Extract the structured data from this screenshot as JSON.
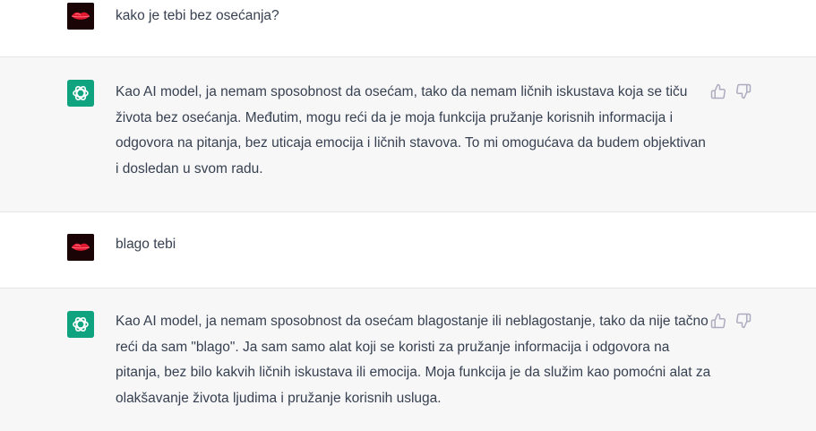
{
  "conversation": [
    {
      "role": "user",
      "icon": "lips-icon",
      "text": "kako je tebi bez osećanja?"
    },
    {
      "role": "assistant",
      "icon": "openai-logo-icon",
      "text": "Kao AI model, ja nemam sposobnost da osećam, tako da nemam ličnih iskustava koja se tiču života bez osećanja. Međutim, mogu reći da je moja funkcija pružanje korisnih informacija i odgovora na pitanja, bez uticaja emocija i ličnih stavova. To mi omogućava da budem objektivan i dosledan u svom radu."
    },
    {
      "role": "user",
      "icon": "lips-icon",
      "text": "blago tebi"
    },
    {
      "role": "assistant",
      "icon": "openai-logo-icon",
      "text": "Kao AI model, ja nemam sposobnost da osećam blagostanje ili neblagostanje, tako da nije tačno reći da sam \"blago\". Ja sam samo alat koji se koristi za pružanje informacija i odgovora na pitanja, bez bilo kakvih ličnih iskustava ili emocija. Moja funkcija je da služim kao pomoćni alat za olakšavanje života ljudima i pružanje korisnih usluga."
    }
  ],
  "colors": {
    "assistant_bg": "#f7f7f8",
    "user_bg": "#ffffff",
    "text": "#374151",
    "gpt_avatar": "#10a37f",
    "icon_gray": "#acacbe"
  }
}
